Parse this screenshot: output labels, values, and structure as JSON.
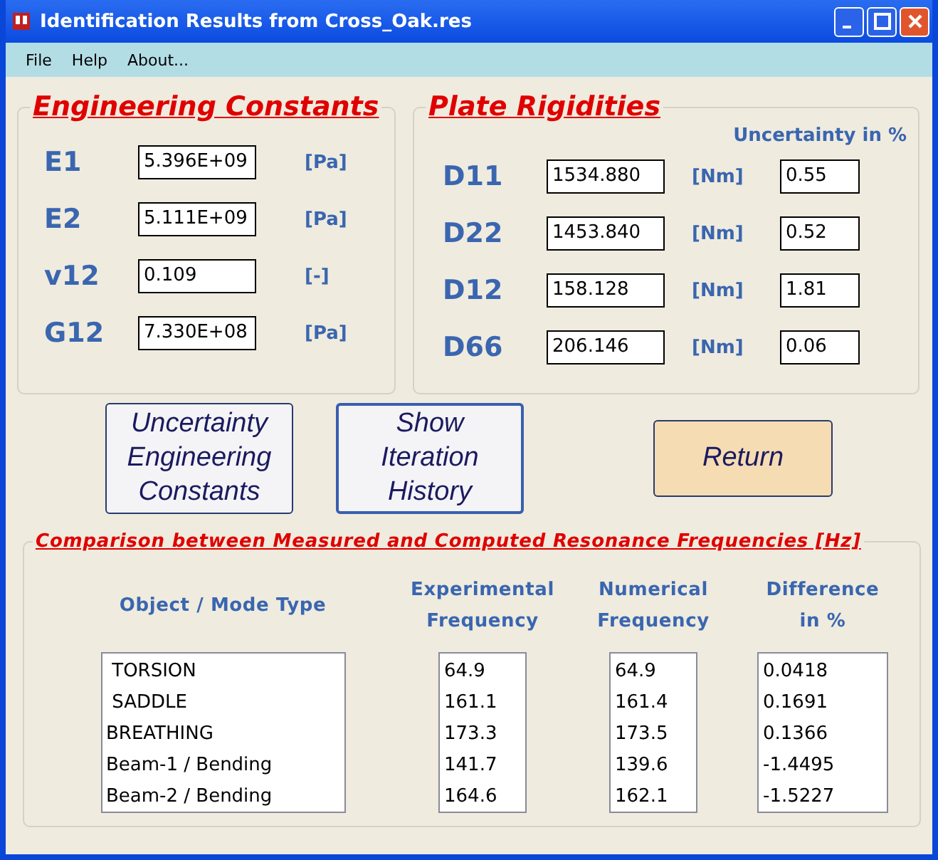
{
  "window": {
    "title": "Identification Results from Cross_Oak.res"
  },
  "menu": [
    "File",
    "Help",
    "About..."
  ],
  "engineering": {
    "title": "Engineering Constants",
    "rows": [
      {
        "label": "E1",
        "value": "5.396E+09",
        "unit": "[Pa]"
      },
      {
        "label": "E2",
        "value": "5.111E+09",
        "unit": "[Pa]"
      },
      {
        "label": "v12",
        "value": "0.109",
        "unit": "[-]"
      },
      {
        "label": "G12",
        "value": "7.330E+08",
        "unit": "[Pa]"
      }
    ]
  },
  "plate": {
    "title": "Plate Rigidities",
    "uncertainty_header": "Uncertainty in %",
    "rows": [
      {
        "label": "D11",
        "value": "1534.880",
        "unit": "[Nm]",
        "uncertainty": "0.55"
      },
      {
        "label": "D22",
        "value": "1453.840",
        "unit": "[Nm]",
        "uncertainty": "0.52"
      },
      {
        "label": "D12",
        "value": "158.128",
        "unit": "[Nm]",
        "uncertainty": "1.81"
      },
      {
        "label": "D66",
        "value": "206.146",
        "unit": "[Nm]",
        "uncertainty": "0.06"
      }
    ]
  },
  "buttons": [
    {
      "kind": "blue",
      "lines": [
        "Uncertainty",
        "Engineering",
        "Constants"
      ]
    },
    {
      "kind": "blue",
      "lines": [
        "Show",
        "Iteration",
        "History"
      ]
    },
    {
      "kind": "orange",
      "lines": [
        "Return"
      ]
    }
  ],
  "comparison": {
    "title": "Comparison between Measured and Computed Resonance Frequencies [Hz]",
    "columns": [
      {
        "header": [
          "Object / Mode Type"
        ],
        "values": [
          " TORSION",
          " SADDLE",
          "BREATHING",
          "Beam-1 / Bending",
          "Beam-2 / Bending"
        ]
      },
      {
        "header": [
          "Experimental",
          "Frequency"
        ],
        "values": [
          "64.9",
          "161.1",
          "173.3",
          "141.7",
          "164.6"
        ]
      },
      {
        "header": [
          "Numerical",
          "Frequency"
        ],
        "values": [
          "64.9",
          "161.4",
          "173.5",
          "139.6",
          "162.1"
        ]
      },
      {
        "header": [
          "Difference",
          "in %"
        ],
        "values": [
          "0.0418",
          "0.1691",
          "0.1366",
          "-1.4495",
          "-1.5227"
        ]
      }
    ]
  }
}
